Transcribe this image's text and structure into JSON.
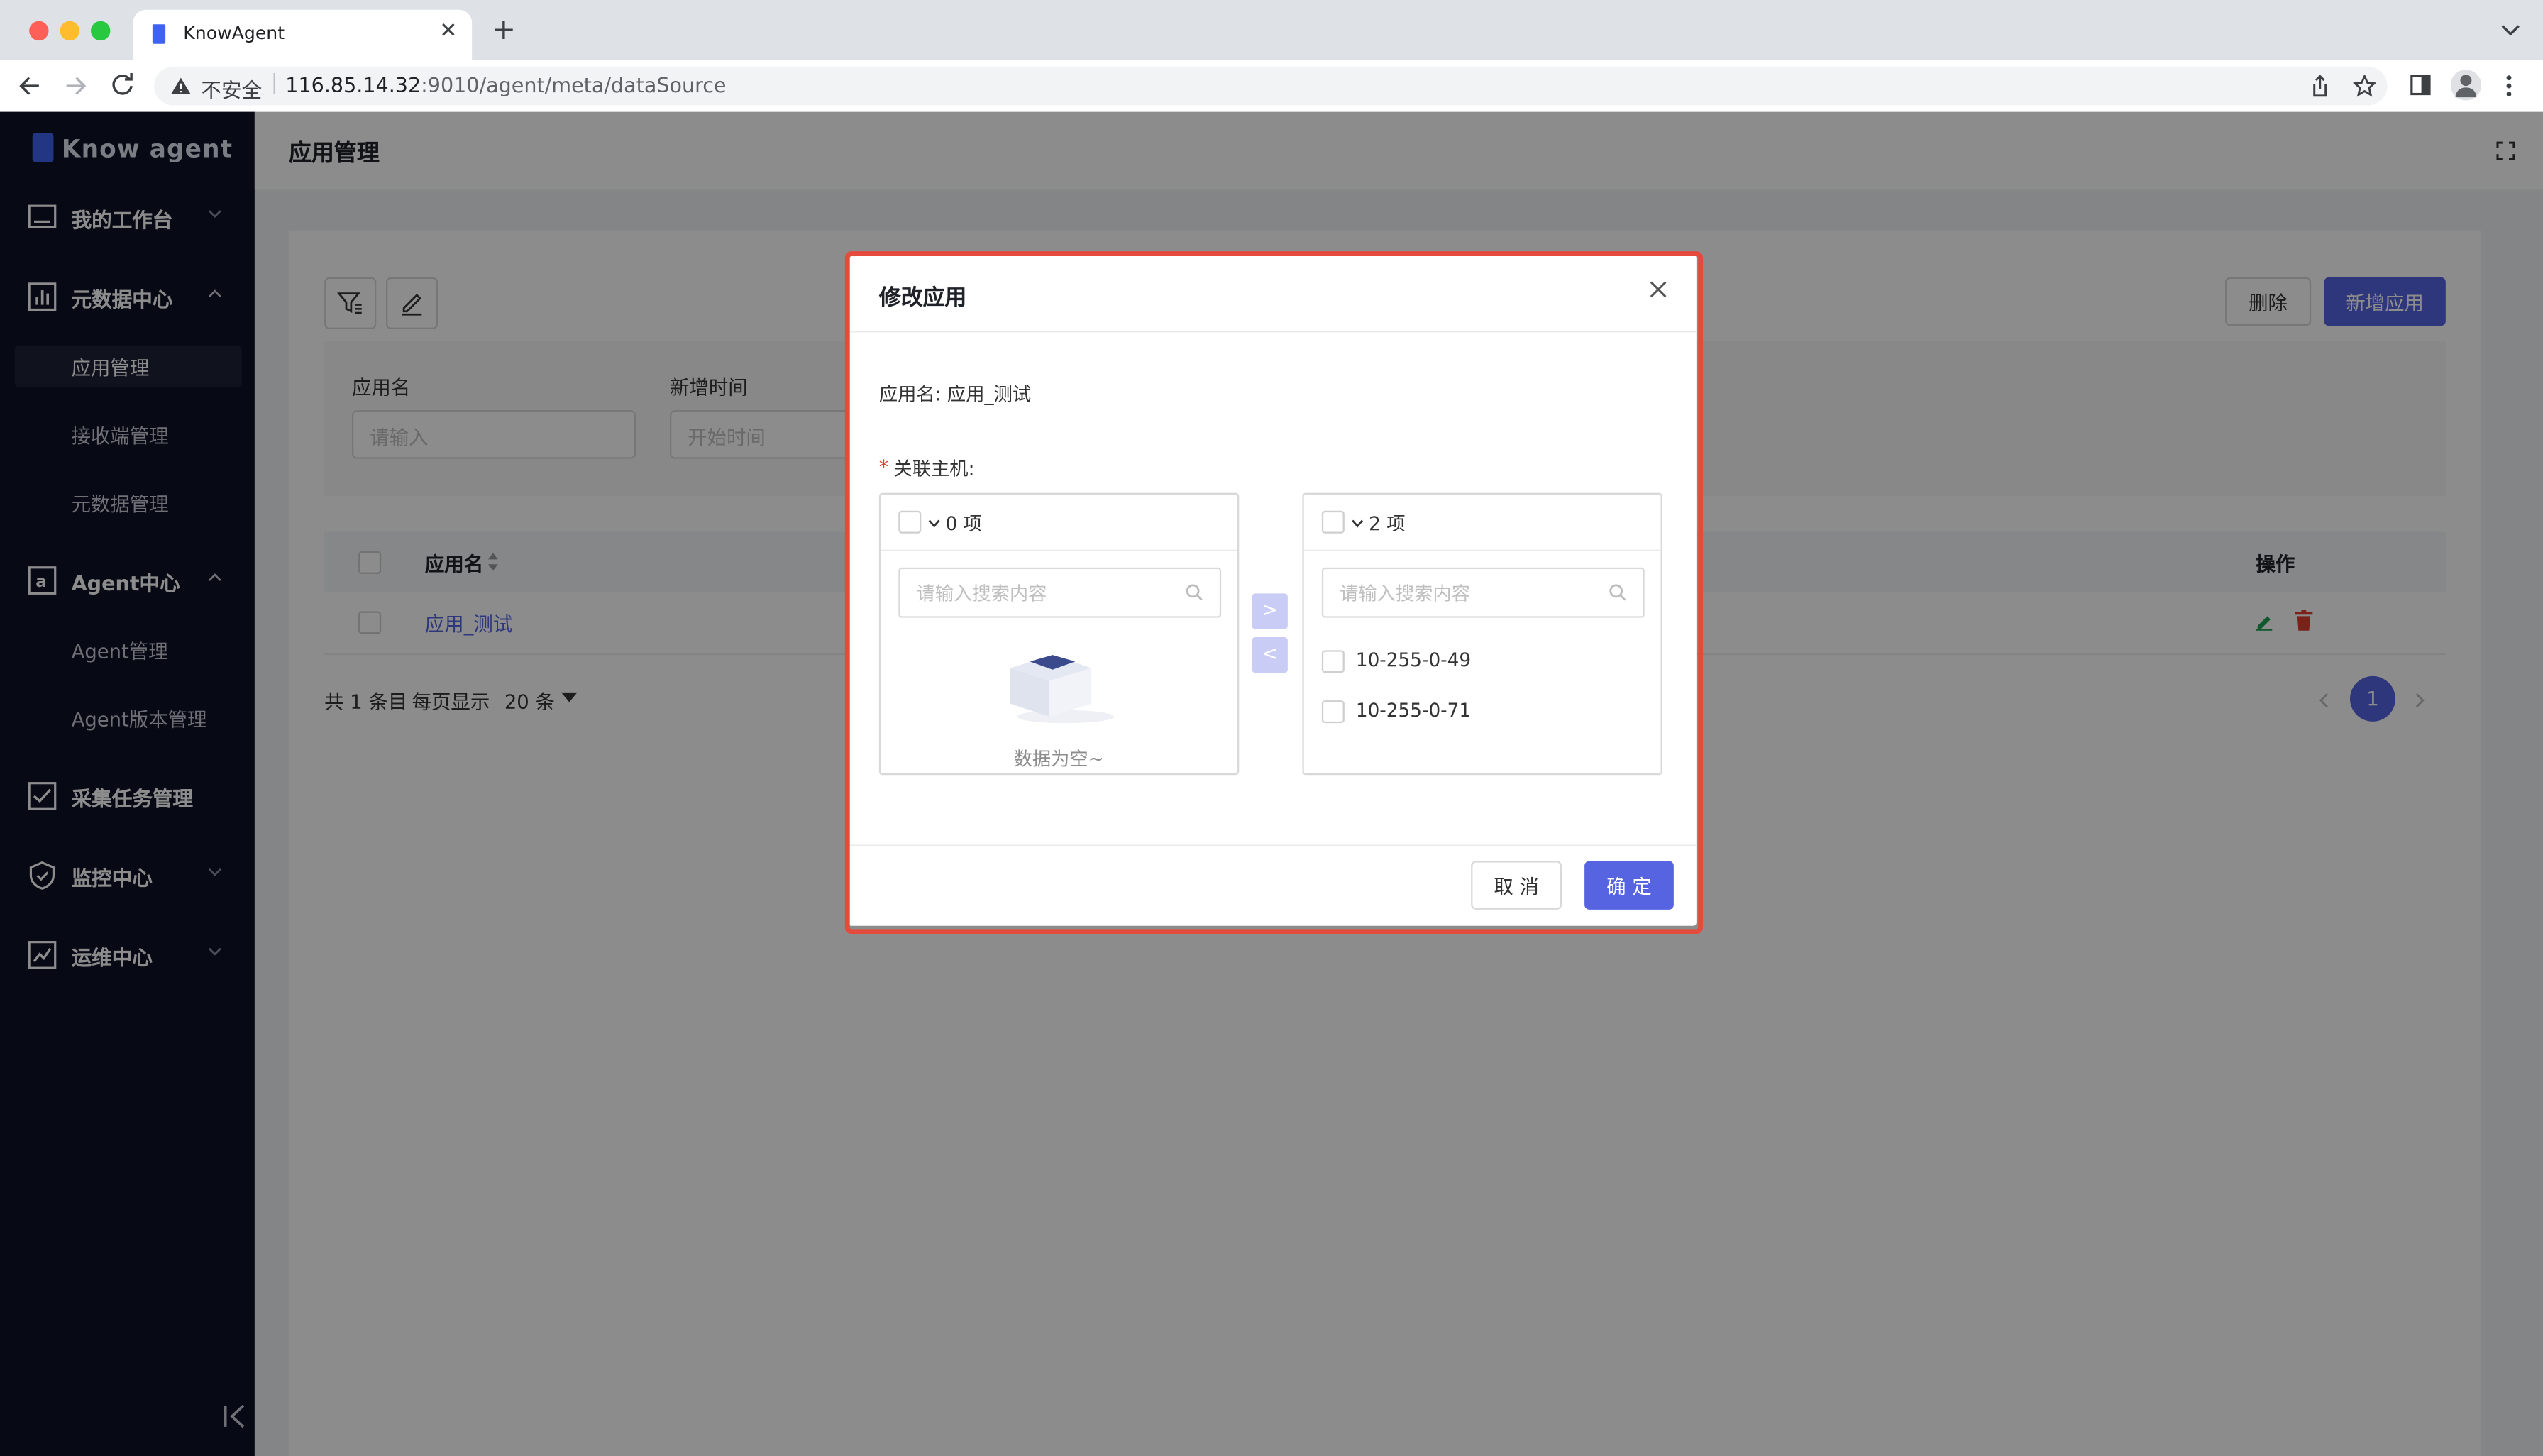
{
  "browser": {
    "tab_title": "KnowAgent",
    "security_label": "不安全",
    "url_host": "116.85.14.32",
    "url_rest": ":9010/agent/meta/dataSource"
  },
  "sidebar": {
    "logo_text": "Know  agent",
    "groups": [
      {
        "label": "我的工作台"
      },
      {
        "label": "元数据中心",
        "children": [
          "应用管理",
          "接收端管理",
          "元数据管理"
        ]
      },
      {
        "label": "Agent中心",
        "children": [
          "Agent管理",
          "Agent版本管理"
        ]
      },
      {
        "label": "采集任务管理"
      },
      {
        "label": "监控中心"
      },
      {
        "label": "运维中心"
      }
    ]
  },
  "page": {
    "title": "应用管理",
    "delete_label": "删除",
    "add_label": "新增应用",
    "filters": {
      "app_name_label": "应用名",
      "app_name_placeholder": "请输入",
      "time_label": "新增时间",
      "time_placeholder": "开始时间"
    },
    "table": {
      "col_name": "应用名",
      "col_ops": "操作",
      "rows": [
        {
          "name": "应用_测试"
        }
      ]
    },
    "pagination": {
      "total_text": "共 1 条目",
      "page_size_label": "每页显示",
      "page_size": "20 条",
      "current_page": "1"
    }
  },
  "modal": {
    "title": "修改应用",
    "app_name_line": "应用名: 应用_测试",
    "host_label": "关联主机:",
    "left_panel": {
      "count": "0 项",
      "search_placeholder": "请输入搜索内容",
      "empty_text": "数据为空~"
    },
    "right_panel": {
      "count": "2 项",
      "search_placeholder": "请输入搜索内容",
      "items": [
        "10-255-0-49",
        "10-255-0-71"
      ]
    },
    "cancel_label": "取 消",
    "ok_label": "确 定"
  },
  "colors": {
    "primary": "#5664e2",
    "sidebar_bg": "#0d1127",
    "highlight_border": "#e54b3c"
  }
}
